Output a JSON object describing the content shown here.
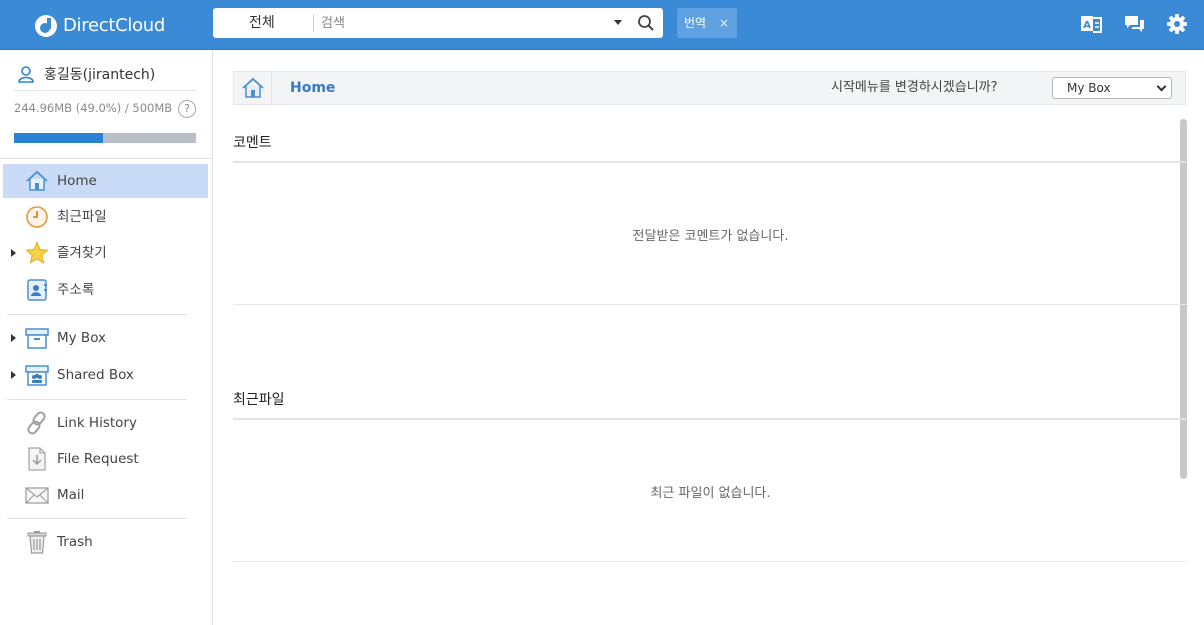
{
  "app": {
    "logo_text": "DirectCloud",
    "brand_color": "#3a8ad6"
  },
  "search": {
    "scope_label": "전체",
    "placeholder": "검색"
  },
  "translate_chip": {
    "label": "번역",
    "close": "×"
  },
  "header_icons": [
    "translate-icon",
    "comments-icon",
    "gear-icon"
  ],
  "user": {
    "name": "홍길동(jirantech)",
    "usage_text": "244.96MB (49.0%) / 500MB",
    "usage_fraction": 0.49,
    "help": "?"
  },
  "sidebar": {
    "items": [
      {
        "label": "Home",
        "icon": "home-icon",
        "active": true
      },
      {
        "label": "최근파일",
        "icon": "clock-icon"
      },
      {
        "label": "즐겨찾기",
        "icon": "star-icon",
        "expandable": true
      },
      {
        "label": "주소록",
        "icon": "address-book-icon"
      },
      {
        "label": "My Box",
        "icon": "box-icon",
        "expandable": true
      },
      {
        "label": "Shared Box",
        "icon": "shared-box-icon",
        "expandable": true
      },
      {
        "label": "Link History",
        "icon": "link-icon"
      },
      {
        "label": "File Request",
        "icon": "file-request-icon"
      },
      {
        "label": "Mail",
        "icon": "mail-icon"
      },
      {
        "label": "Trash",
        "icon": "trash-icon"
      }
    ]
  },
  "breadcrumb": {
    "title": "Home",
    "question": "시작메뉴를 변경하시겠습니까?",
    "select_value": "My Box"
  },
  "sections": [
    {
      "title": "코멘트",
      "empty_text": "전달받은 코멘트가 없습니다."
    },
    {
      "title": "최근파일",
      "empty_text": "최근 파일이 없습니다."
    }
  ]
}
